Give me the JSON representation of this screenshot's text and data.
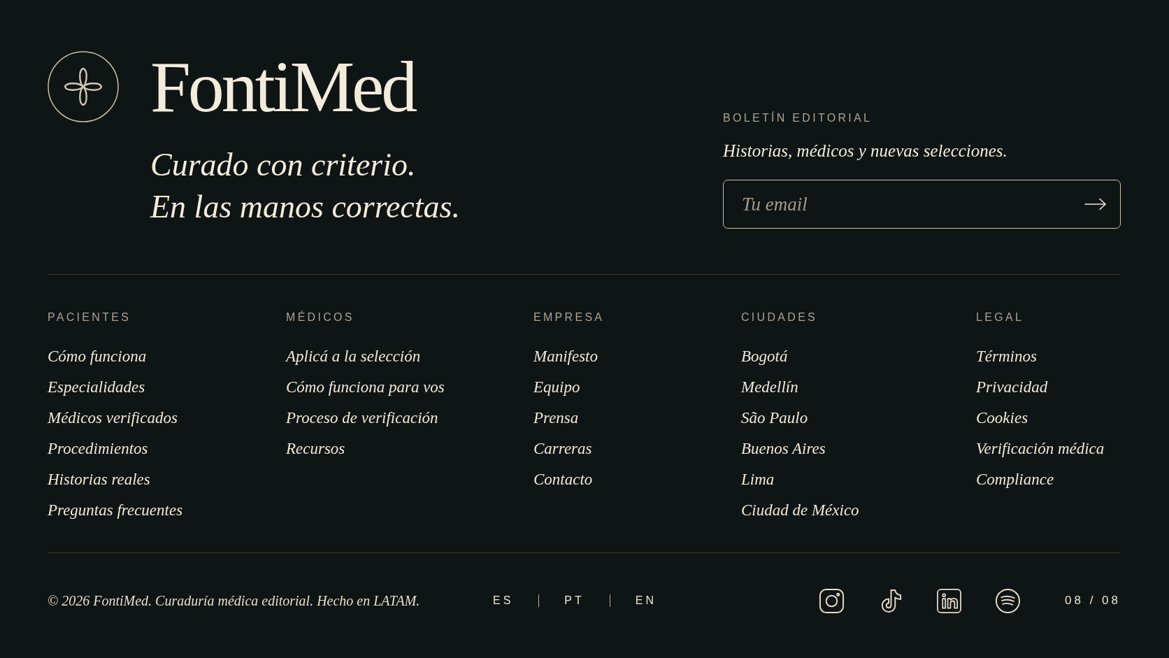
{
  "brand": {
    "name": "FontiMed",
    "tagline": [
      "Curado con criterio.",
      "En las manos correctas."
    ]
  },
  "newsletter": {
    "heading": "BOLETÍN EDITORIAL",
    "description": "Historias, médicos y nuevas selecciones.",
    "email_field": {
      "placeholder": "Tu email"
    }
  },
  "link_columns": [
    {
      "heading": "PACIENTES",
      "links": [
        "Cómo funciona",
        "Especialidades",
        "Médicos verificados",
        "Procedimientos",
        "Historias reales",
        "Preguntas frecuentes"
      ]
    },
    {
      "heading": "MÉDICOS",
      "links": [
        "Aplicá a la selección",
        "Cómo funciona para vos",
        "Proceso de verificación",
        "Recursos"
      ]
    },
    {
      "heading": "EMPRESA",
      "links": [
        "Manifesto",
        "Equipo",
        "Prensa",
        "Carreras",
        "Contacto"
      ]
    },
    {
      "heading": "CIUDADES",
      "links": [
        "Bogotá",
        "Medellín",
        "São Paulo",
        "Buenos Aires",
        "Lima",
        "Ciudad de México"
      ]
    },
    {
      "heading": "LEGAL",
      "links": [
        "Términos",
        "Privacidad",
        "Cookies",
        "Verificación médica",
        "Compliance"
      ]
    }
  ],
  "bottom_bar": {
    "copyright": "© 2026 FontiMed. Curaduría médica editorial. Hecho en LATAM.",
    "languages": [
      "ES",
      "PT",
      "EN"
    ],
    "page_counter": "08 / 08"
  }
}
